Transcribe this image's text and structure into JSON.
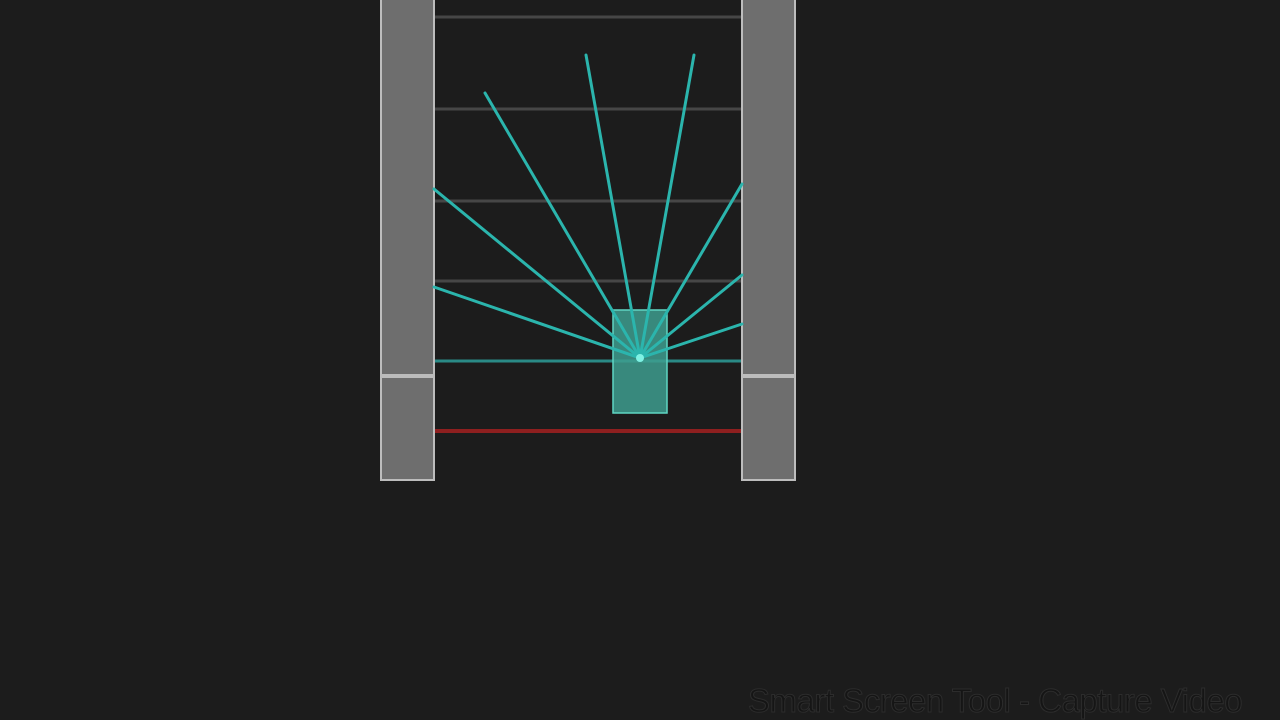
{
  "watermark": {
    "text": "Smart Screen Tool - Capture Video"
  },
  "colors": {
    "background": "#1c1c1c",
    "wall": "#6e6e6e",
    "wall_edge": "#bdbdbd",
    "wall_joint": "#a6a6a6",
    "rail": "#4a4a4a",
    "ray": "#2bb5ad",
    "player_fill": "#3d9c8e",
    "player_edge": "#5fd6c3",
    "deadline": "#8e1f1f"
  },
  "icons": {
    "player": "player-block",
    "rays": "sensor-rays",
    "hazard": "red-deadline"
  }
}
